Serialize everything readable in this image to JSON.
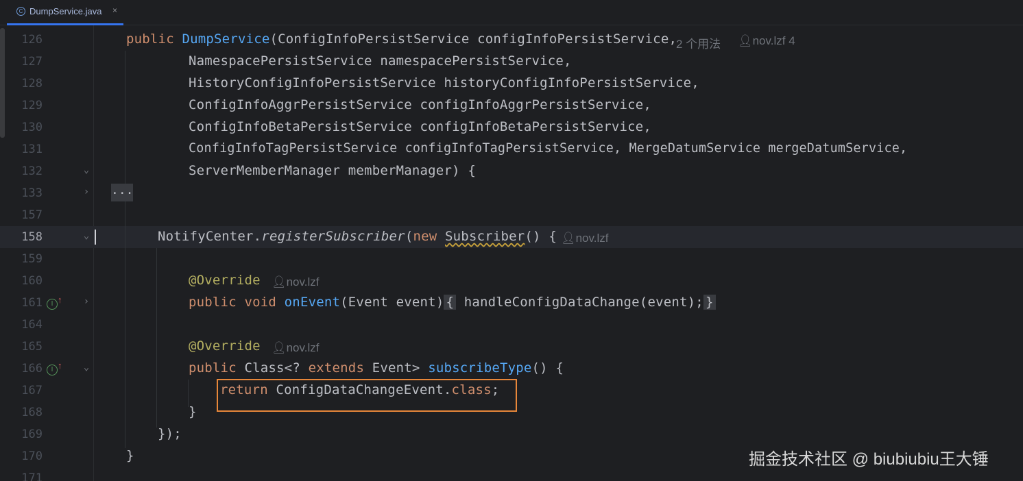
{
  "tab": {
    "icon": "class-icon",
    "filename": "DumpService.java",
    "close": "×"
  },
  "lines": [
    {
      "n": "126"
    },
    {
      "n": "127"
    },
    {
      "n": "128"
    },
    {
      "n": "129"
    },
    {
      "n": "130"
    },
    {
      "n": "131"
    },
    {
      "n": "132"
    },
    {
      "n": "133"
    },
    {
      "n": "157"
    },
    {
      "n": "158"
    },
    {
      "n": "159"
    },
    {
      "n": "160"
    },
    {
      "n": "161"
    },
    {
      "n": "164"
    },
    {
      "n": "165"
    },
    {
      "n": "166"
    },
    {
      "n": "167"
    },
    {
      "n": "168"
    },
    {
      "n": "169"
    },
    {
      "n": "170"
    },
    {
      "n": "171"
    }
  ],
  "code": {
    "l126_kw": "public",
    "l126_fn": "DumpService",
    "l126_rest": "(ConfigInfoPersistService configInfoPersistService,",
    "l126_hint1": "2 个用法",
    "l126_hint2": "nov.lzf 4",
    "l127": "NamespacePersistService namespacePersistService,",
    "l128": "HistoryConfigInfoPersistService historyConfigInfoPersistService,",
    "l129": "ConfigInfoAggrPersistService configInfoAggrPersistService,",
    "l130": "ConfigInfoBetaPersistService configInfoBetaPersistService,",
    "l131": "ConfigInfoTagPersistService configInfoTagPersistService, MergeDatumService mergeDatumService,",
    "l132": "ServerMemberManager memberManager) {",
    "l133_fold": "...",
    "l158_a": "NotifyCenter.",
    "l158_b": "registerSubscriber",
    "l158_c": "(",
    "l158_kw": "new",
    "l158_cls": "Subscriber",
    "l158_d": "() {",
    "l158_hint": "nov.lzf",
    "l160_ann": "@Override",
    "l160_hint": "nov.lzf",
    "l161_kw": "public void",
    "l161_fn": "onEvent",
    "l161_a": "(Event event)",
    "l161_b1": "{",
    "l161_body": " handleConfigDataChange(event);",
    "l161_b2": "}",
    "l165_ann": "@Override",
    "l165_hint": "nov.lzf",
    "l166_kw": "public",
    "l166_a": "Class<?",
    "l166_kw2": "extends",
    "l166_b": "Event>",
    "l166_fn": "subscribeType",
    "l166_c": "() {",
    "l167_kw": "return",
    "l167_a": "ConfigDataChangeEvent.",
    "l167_kw2": "class",
    "l167_b": ";",
    "l168": "}",
    "l169": "});",
    "l170": "}"
  },
  "watermark": "掘金技术社区 @ biubiubiu王大锤"
}
